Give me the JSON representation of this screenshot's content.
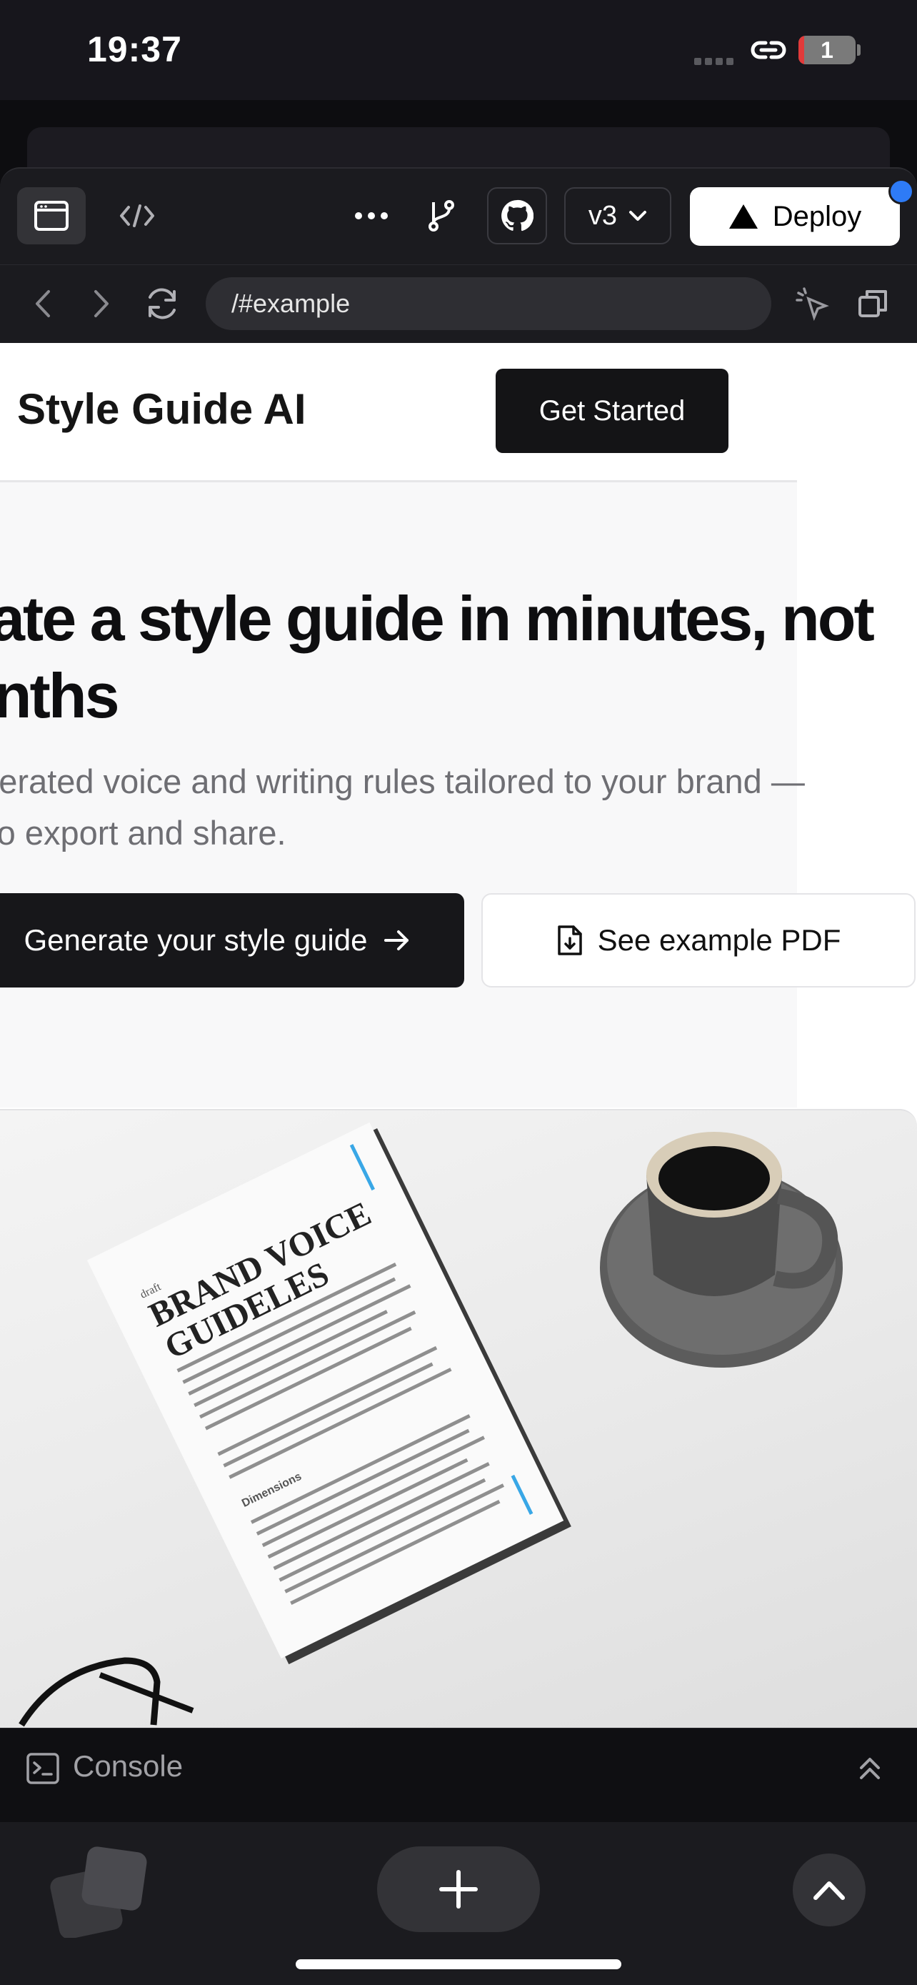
{
  "status_bar": {
    "time": "19:37",
    "battery": "1"
  },
  "toolbar": {
    "version_label": "v3",
    "deploy_label": "Deploy",
    "icons": [
      "preview-icon",
      "code-icon",
      "more-icon",
      "branch-icon",
      "github-icon",
      "chevron-down-icon",
      "triangle-icon"
    ]
  },
  "browser": {
    "url": "/#example"
  },
  "site": {
    "brand": "Style Guide AI",
    "get_started": "Get Started",
    "headline_line1": "eate a style guide in minutes, not",
    "headline_line2": "onths",
    "sub_line1": "enerated voice and writing rules tailored to your brand —",
    "sub_line2": "y to export and share.",
    "cta_primary": "Generate your style guide",
    "cta_secondary": "See example PDF"
  },
  "photo": {
    "document_tag": "draft",
    "document_title_line1": "BRAND VOICE",
    "document_title_line2": "GUIDELES",
    "section_heading": "Dimensions"
  },
  "console": {
    "label": "Console"
  },
  "colors": {
    "accent_dot": "#2e7bf6",
    "page_bg": "#ffffff",
    "chrome_bg": "#1b1b1f"
  }
}
